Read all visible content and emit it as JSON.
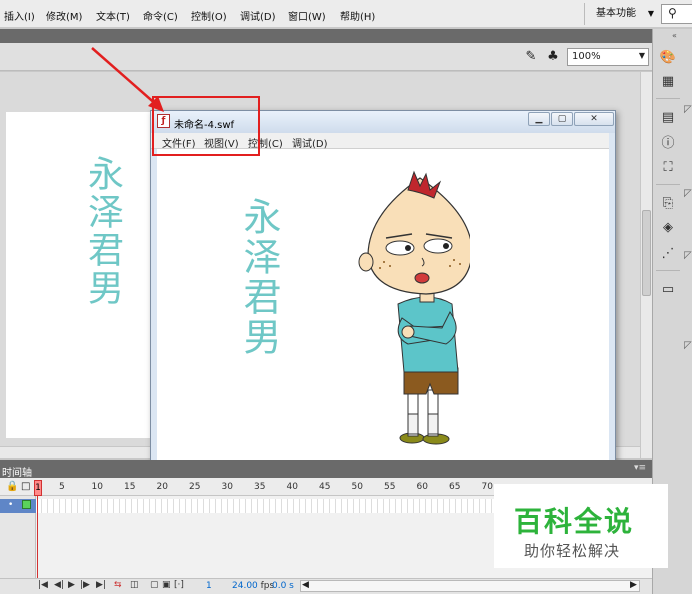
{
  "menubar": {
    "items": [
      "插入(I)",
      "修改(M)",
      "文本(T)",
      "命令(C)",
      "控制(O)",
      "调试(D)",
      "窗口(W)",
      "帮助(H)"
    ],
    "workspace": "基本功能"
  },
  "editbar": {
    "zoom": "100%"
  },
  "stage": {
    "text": "永泽君男"
  },
  "swf_window": {
    "title": "未命名-4.swf",
    "menu": [
      "文件(F)",
      "视图(V)",
      "控制(C)",
      "调试(D)"
    ],
    "text": "永泽君男"
  },
  "timeline": {
    "label": "时间轴",
    "frame_numbers": [
      "1",
      "5",
      "10",
      "15",
      "20",
      "25",
      "30",
      "35",
      "40",
      "45",
      "50",
      "55",
      "60",
      "65",
      "70"
    ],
    "current_frame": "1",
    "fps": "24.00",
    "fps_unit": "fps",
    "time": "0.0 s"
  },
  "watermark": {
    "title": "百科全说",
    "subtitle": "助你轻松解决"
  },
  "colors": {
    "accent_red": "#e21f1f",
    "stage_text": "#6fc7c6",
    "watermark_green": "#2db33b"
  }
}
